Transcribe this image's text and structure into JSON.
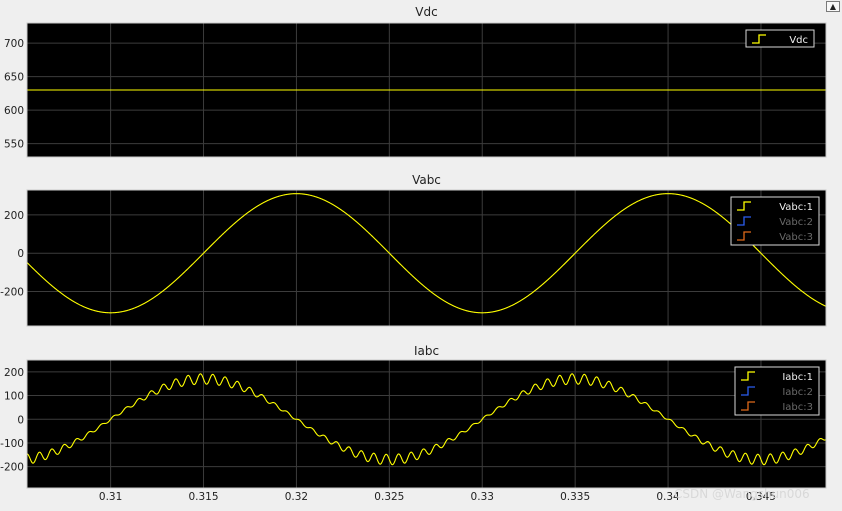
{
  "window": {
    "menu_icon": "expand-icon"
  },
  "watermark": "CSDN @Wangshun006",
  "colors": {
    "background": "#000000",
    "axes_border": "#c8c8c8",
    "grid": "#3c3c3c",
    "tick_text": "#d0d0d0",
    "window_bg": "#efefef",
    "series": [
      "#ffff00",
      "#2b5ef0",
      "#e06a1a"
    ]
  },
  "chart_data": [
    {
      "type": "line",
      "title": "Vdc",
      "xlim": [
        0.3055,
        0.3485
      ],
      "ylim": [
        530,
        730
      ],
      "yticks": [
        550,
        600,
        650,
        700
      ],
      "xticks": [
        0.31,
        0.315,
        0.32,
        0.325,
        0.33,
        0.335,
        0.34,
        0.345
      ],
      "grid": true,
      "legend_position": "top-right",
      "series": [
        {
          "name": "Vdc",
          "color": "#ffff00",
          "constant": 630
        }
      ]
    },
    {
      "type": "line",
      "title": "Vabc",
      "xlim": [
        0.3055,
        0.3485
      ],
      "ylim": [
        -380,
        330
      ],
      "yticks": [
        -200,
        0,
        200
      ],
      "xticks": [
        0.31,
        0.315,
        0.32,
        0.325,
        0.33,
        0.335,
        0.34,
        0.345
      ],
      "grid": true,
      "legend_position": "top-right",
      "series": [
        {
          "name": "Vabc:1",
          "color": "#ffff00",
          "amplitude": 311,
          "frequency_hz": 50,
          "phase_deg": 90,
          "visible": true
        },
        {
          "name": "Vabc:2",
          "color": "#2b5ef0",
          "visible": false
        },
        {
          "name": "Vabc:3",
          "color": "#e06a1a",
          "visible": false
        }
      ]
    },
    {
      "type": "line",
      "title": "Iabc",
      "xlim": [
        0.3055,
        0.3485
      ],
      "ylim": [
        -290,
        250
      ],
      "yticks": [
        -200,
        -100,
        0,
        100,
        200
      ],
      "xticks": [
        0.31,
        0.315,
        0.32,
        0.325,
        0.33,
        0.335,
        0.34,
        0.345
      ],
      "xticklabels": [
        "0.31",
        "0.315",
        "0.32",
        "0.325",
        "0.33",
        "0.335",
        "0.34",
        "0.345"
      ],
      "grid": true,
      "legend_position": "top-right",
      "series": [
        {
          "name": "Iabc:1",
          "color": "#ffff00",
          "amplitude": 170,
          "frequency_hz": 50,
          "phase_deg": 180,
          "ripple_amplitude": 22,
          "visible": true
        },
        {
          "name": "Iabc:2",
          "color": "#2b5ef0",
          "visible": false
        },
        {
          "name": "Iabc:3",
          "color": "#e06a1a",
          "visible": false
        }
      ]
    }
  ]
}
